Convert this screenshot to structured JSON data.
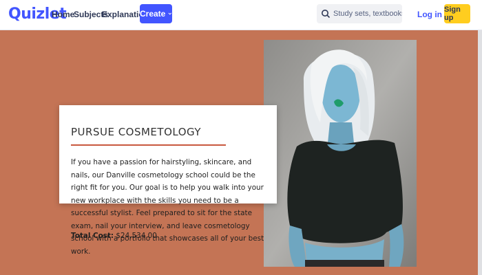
{
  "header": {
    "logo": "Quizlet",
    "nav": [
      "Home",
      "Subjects",
      "Explanations"
    ],
    "create_label": "Create",
    "search_placeholder": "Study sets, textbooks, ...",
    "login_label": "Log in",
    "signup_label": "Sign up"
  },
  "colors": {
    "brand": "#4255ff",
    "page_background": "#c47455",
    "accent_rule": "#c8573d",
    "signup": "#ffcd1f"
  },
  "hero": {
    "title": "PURSUE COSMETOLOGY",
    "description": "If you have a passion for hairstyling, skincare, and nails, our Danville cosmetology school could be the right fit for you. Our goal is to help you walk into your new workplace with the skills you need to be a successful stylist. Feel prepared to sit for the state exam, nail your interview, and leave cosmetology school with a portfolio that showcases all of your best work.",
    "cost_label": "Total Cost:",
    "cost_value": "$24,534.00"
  }
}
